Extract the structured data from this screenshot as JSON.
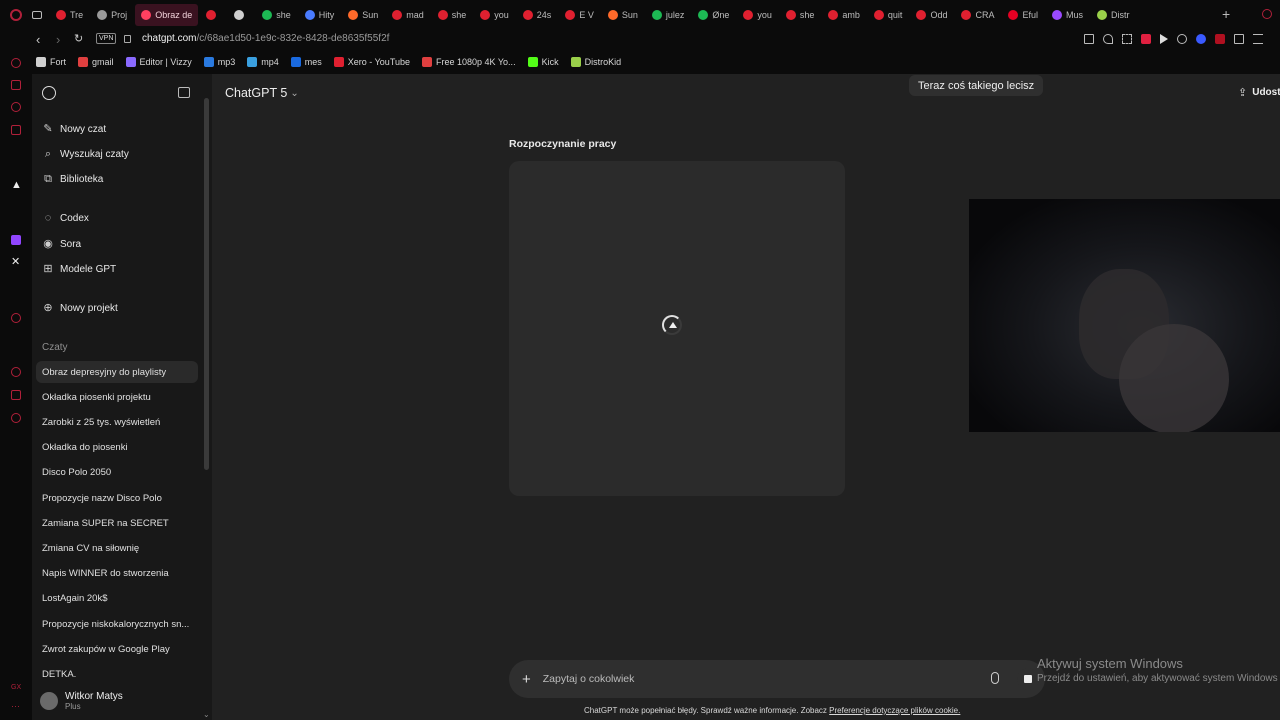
{
  "browser": {
    "tabs": [
      {
        "label": "Tre",
        "color": "#e02030"
      },
      {
        "label": "Proj",
        "color": "#9a9a9a"
      },
      {
        "label": "Obraz de",
        "color": "#ff4060",
        "active": true
      },
      {
        "label": "",
        "color": "#e02030"
      },
      {
        "label": "",
        "color": "#cfcfcf"
      },
      {
        "label": "she",
        "color": "#1db954"
      },
      {
        "label": "Hity",
        "color": "#4a7cff"
      },
      {
        "label": "Sun",
        "color": "#ff6a2a"
      },
      {
        "label": "mad",
        "color": "#e02030"
      },
      {
        "label": "she",
        "color": "#e02030"
      },
      {
        "label": "you",
        "color": "#e02030"
      },
      {
        "label": "24s",
        "color": "#e02030"
      },
      {
        "label": "E V",
        "color": "#e02030"
      },
      {
        "label": "Sun",
        "color": "#ff6a2a"
      },
      {
        "label": "julez",
        "color": "#1db954"
      },
      {
        "label": "Øne",
        "color": "#1db954"
      },
      {
        "label": "you",
        "color": "#e02030"
      },
      {
        "label": "she",
        "color": "#e02030"
      },
      {
        "label": "amb",
        "color": "#e02030"
      },
      {
        "label": "quit",
        "color": "#e02030"
      },
      {
        "label": "Odd",
        "color": "#e02030"
      },
      {
        "label": "CRA",
        "color": "#e02030"
      },
      {
        "label": "Eful",
        "color": "#e60023"
      },
      {
        "label": "Mus",
        "color": "#9a4aff"
      },
      {
        "label": "Distr",
        "color": "#9ad04a"
      }
    ],
    "vpn_label": "VPN",
    "url_domain": "chatgpt.com",
    "url_path": "/c/68ae1d50-1e9c-832e-8428-de8635f55f2f",
    "bookmarks": [
      {
        "label": "Fort",
        "color": "#cfcfcf"
      },
      {
        "label": "gmail",
        "color": "#e04040"
      },
      {
        "label": "Editor | Vizzy",
        "color": "#8a6aff"
      },
      {
        "label": "mp3",
        "color": "#2a7ae0"
      },
      {
        "label": "mp4",
        "color": "#3aa0e0"
      },
      {
        "label": "mes",
        "color": "#1a6ae0"
      },
      {
        "label": "Xero - YouTube",
        "color": "#e02030"
      },
      {
        "label": "Free 1080p 4K Yo...",
        "color": "#e04040"
      },
      {
        "label": "Kick",
        "color": "#53fc18"
      },
      {
        "label": "DistroKid",
        "color": "#9ad04a"
      }
    ]
  },
  "sidebar": {
    "nav": [
      {
        "label": "Nowy czat",
        "icon": "edit-icon"
      },
      {
        "label": "Wyszukaj czaty",
        "icon": "search-icon"
      },
      {
        "label": "Biblioteka",
        "icon": "library-icon"
      },
      {
        "label": "Codex",
        "icon": "codex-icon"
      },
      {
        "label": "Sora",
        "icon": "sora-icon"
      },
      {
        "label": "Modele GPT",
        "icon": "grid-icon"
      },
      {
        "label": "Nowy projekt",
        "icon": "folder-plus-icon"
      }
    ],
    "chats_heading": "Czaty",
    "chats": [
      "Obraz depresyjny do playlisty",
      "Okładka piosenki projektu",
      "Zarobki z 25 tys. wyświetleń",
      "Okładka do piosenki",
      "Disco Polo 2050",
      "Propozycje nazw Disco Polo",
      "Zamiana SUPER na SECRET",
      "Zmiana CV na siłownię",
      "Napis WINNER do stworzenia",
      "LostAgain 20k$",
      "Propozycje niskokalorycznych sn...",
      "Zwrot zakupów w Google Play",
      "DETKA."
    ],
    "user_name": "Witkor Matys",
    "user_plan": "Plus"
  },
  "main": {
    "model_label": "ChatGPT 5",
    "share_label": "Udost",
    "now_playing_tooltip": "Teraz coś takiego lecisz",
    "generating_label": "Rozpoczynanie pracy",
    "composer_placeholder": "Zapytaj o cokolwiek",
    "disclaimer_text": "ChatGPT może popełniać błędy. Sprawdź ważne informacje. Zobacz",
    "disclaimer_link": "Preferencje dotyczące plików cookie.",
    "activation_title": "Aktywuj system Windows",
    "activation_sub": "Przejdź do ustawień, aby aktywować system Windows"
  },
  "colors": {
    "accent_red": "#b0203a",
    "background": "#212121",
    "sidebar": "#181818"
  }
}
